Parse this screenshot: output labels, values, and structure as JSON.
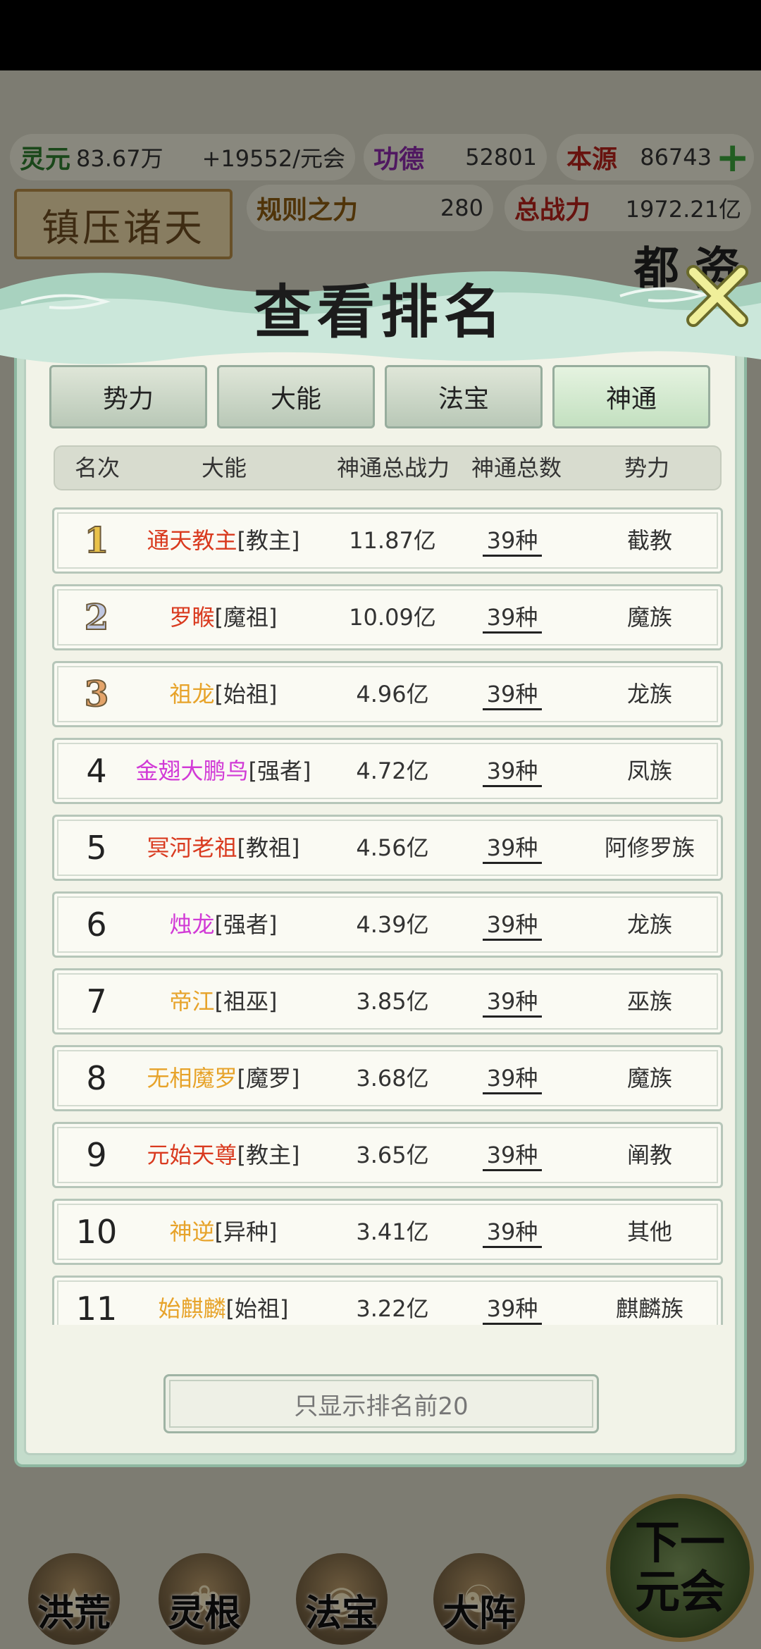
{
  "background": {
    "resources": {
      "lingyuan_label": "灵元",
      "lingyuan_value": "83.67万",
      "rate": "+19552/元会",
      "gongde_label": "功德",
      "gongde_value": "52801",
      "benyuan_label": "本源",
      "benyuan_value": "86743"
    },
    "stats": {
      "rule_label": "规则之力",
      "rule_value": "280",
      "total_label": "总战力",
      "total_value": "1972.21亿"
    },
    "board_title": "镇压诸天",
    "partial_text": "都 资"
  },
  "modal": {
    "title": "查看排名",
    "tabs": [
      {
        "label": "势力",
        "active": false
      },
      {
        "label": "大能",
        "active": false
      },
      {
        "label": "法宝",
        "active": false
      },
      {
        "label": "神通",
        "active": true
      }
    ],
    "columns": [
      "名次",
      "大能",
      "神通总战力",
      "神通总数",
      "势力"
    ],
    "rows": [
      {
        "rank": "1",
        "name": "通天教主",
        "title": "[教主]",
        "power": "11.87亿",
        "count": "39种",
        "faction": "截教",
        "name_color": "#d93a1f"
      },
      {
        "rank": "2",
        "name": "罗睺",
        "title": "[魔祖]",
        "power": "10.09亿",
        "count": "39种",
        "faction": "魔族",
        "name_color": "#d93a1f"
      },
      {
        "rank": "3",
        "name": "祖龙",
        "title": "[始祖]",
        "power": "4.96亿",
        "count": "39种",
        "faction": "龙族",
        "name_color": "#e7a32a"
      },
      {
        "rank": "4",
        "name": "金翅大鹏鸟",
        "title": "[强者]",
        "power": "4.72亿",
        "count": "39种",
        "faction": "凤族",
        "name_color": "#d13ad6"
      },
      {
        "rank": "5",
        "name": "冥河老祖",
        "title": "[教祖]",
        "power": "4.56亿",
        "count": "39种",
        "faction": "阿修罗族",
        "name_color": "#d93a1f"
      },
      {
        "rank": "6",
        "name": "烛龙",
        "title": "[强者]",
        "power": "4.39亿",
        "count": "39种",
        "faction": "龙族",
        "name_color": "#d13ad6"
      },
      {
        "rank": "7",
        "name": "帝江",
        "title": "[祖巫]",
        "power": "3.85亿",
        "count": "39种",
        "faction": "巫族",
        "name_color": "#e7a32a"
      },
      {
        "rank": "8",
        "name": "无相魔罗",
        "title": "[魔罗]",
        "power": "3.68亿",
        "count": "39种",
        "faction": "魔族",
        "name_color": "#e7a32a"
      },
      {
        "rank": "9",
        "name": "元始天尊",
        "title": "[教主]",
        "power": "3.65亿",
        "count": "39种",
        "faction": "阐教",
        "name_color": "#d93a1f"
      },
      {
        "rank": "10",
        "name": "神逆",
        "title": "[异种]",
        "power": "3.41亿",
        "count": "39种",
        "faction": "其他",
        "name_color": "#e7a32a"
      },
      {
        "rank": "11",
        "name": "始麒麟",
        "title": "[始祖]",
        "power": "3.22亿",
        "count": "39种",
        "faction": "麒麟族",
        "name_color": "#e7a32a"
      }
    ],
    "show_top_label": "只显示排名前20"
  },
  "bottom_nav": {
    "items": [
      {
        "label": "洪荒",
        "icon": "mountain-icon"
      },
      {
        "label": "灵根",
        "icon": "lotus-icon"
      },
      {
        "label": "法宝",
        "icon": "treasure-icon"
      },
      {
        "label": "大阵",
        "icon": "formation-icon"
      }
    ],
    "next_label_1": "下一",
    "next_label_2": "元会"
  }
}
